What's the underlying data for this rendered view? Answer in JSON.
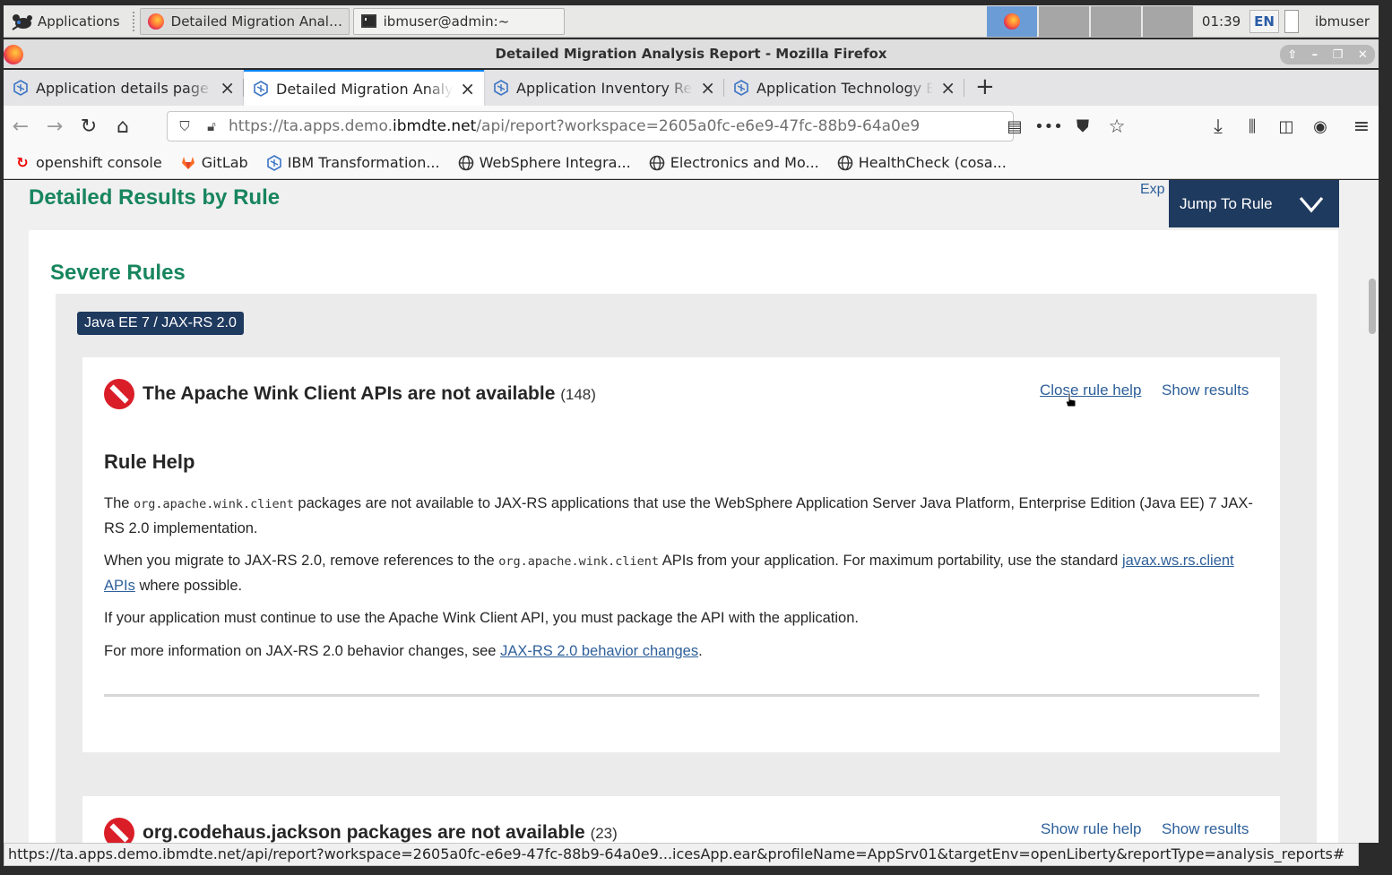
{
  "panel": {
    "apps_label": "Applications",
    "tasks": [
      {
        "label": "Detailed Migration Anal…"
      },
      {
        "label": "ibmuser@admin:~"
      }
    ],
    "clock": "01:39",
    "lang": "EN",
    "user": "ibmuser"
  },
  "window": {
    "title": "Detailed Migration Analysis Report - Mozilla Firefox"
  },
  "tabs": [
    {
      "label": "Application details page"
    },
    {
      "label": "Detailed Migration Analysis Report"
    },
    {
      "label": "Application Inventory Report"
    },
    {
      "label": "Application Technology Evaluation"
    }
  ],
  "nav": {
    "url_prefix": "https://ta.apps.demo.",
    "url_domain": "ibmdte.net",
    "url_suffix": "/api/report?workspace=2605a0fc-e6e9-47fc-88b9-64a0e9"
  },
  "bookmarks": [
    {
      "label": "openshift console",
      "icon": "openshift-icon"
    },
    {
      "label": "GitLab",
      "icon": "gitlab-icon"
    },
    {
      "label": "IBM Transformation...",
      "icon": "ibm-icon"
    },
    {
      "label": "WebSphere Integra...",
      "icon": "globe-icon"
    },
    {
      "label": "Electronics and Mo...",
      "icon": "globe-icon"
    },
    {
      "label": "HealthCheck (cosa...",
      "icon": "globe-icon"
    }
  ],
  "page": {
    "heading": "Detailed Results by Rule",
    "expand_label": "Exp",
    "jump_label": "Jump To Rule",
    "severe_heading": "Severe Rules",
    "tag": "Java EE 7 / JAX-RS 2.0",
    "rule1": {
      "title": "The Apache Wink Client APIs are not available",
      "count": "(148)",
      "close_help": "Close rule help",
      "show_results": "Show results",
      "help_heading": "Rule Help",
      "p1_a": "The ",
      "p1_code": "org.apache.wink.client",
      "p1_b": " packages are not available to JAX-RS applications that use the WebSphere Application Server Java Platform, Enterprise Edition (Java EE) 7 JAX-RS 2.0 implementation.",
      "p2_a": "When you migrate to JAX-RS 2.0, remove references to the ",
      "p2_code": "org.apache.wink.client",
      "p2_b": " APIs from your application. For maximum portability, use the standard ",
      "p2_link": "javax.ws.rs.client APIs",
      "p2_c": " where possible.",
      "p3": "If your application must continue to use the Apache Wink Client API, you must package the API with the application.",
      "p4_a": "For more information on JAX-RS 2.0 behavior changes, see ",
      "p4_link": "JAX-RS 2.0 behavior changes",
      "p4_b": "."
    },
    "rule2": {
      "title": "org.codehaus.jackson packages are not available",
      "count": "(23)",
      "show_help": "Show rule help",
      "show_results": "Show results"
    }
  },
  "status_url": "https://ta.apps.demo.ibmdte.net/api/report?workspace=2605a0fc-e6e9-47fc-88b9-64a0e9...icesApp.ear&profileName=AppSrv01&targetEnv=openLiberty&reportType=analysis_reports#"
}
